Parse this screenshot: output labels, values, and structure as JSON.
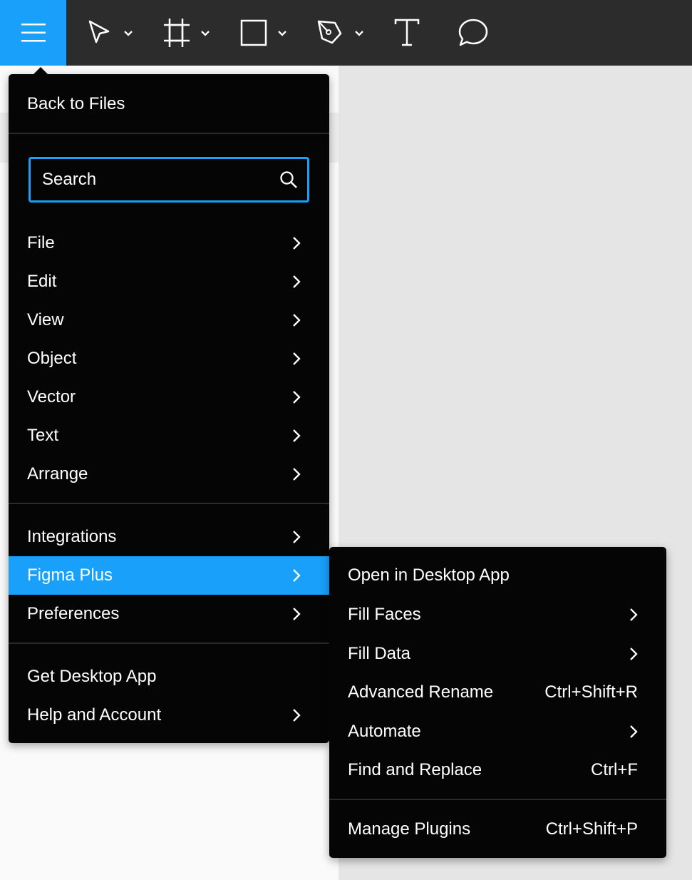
{
  "colors": {
    "accent": "#18a0fb",
    "toolbar_bg": "#2c2c2c",
    "menu_bg": "#050505",
    "canvas": "#e5e5e5"
  },
  "toolbar": {
    "icons": [
      "hamburger-icon",
      "move-tool-icon",
      "frame-tool-icon",
      "rectangle-tool-icon",
      "pen-tool-icon",
      "text-tool-icon",
      "comment-icon"
    ]
  },
  "menu": {
    "back_label": "Back to Files",
    "search": {
      "placeholder": "Search",
      "value": ""
    },
    "group1": [
      {
        "label": "File"
      },
      {
        "label": "Edit"
      },
      {
        "label": "View"
      },
      {
        "label": "Object"
      },
      {
        "label": "Vector"
      },
      {
        "label": "Text"
      },
      {
        "label": "Arrange"
      }
    ],
    "group2": [
      {
        "label": "Integrations"
      },
      {
        "label": "Figma Plus"
      },
      {
        "label": "Preferences"
      }
    ],
    "group3": [
      {
        "label": "Get Desktop App"
      },
      {
        "label": "Help and Account"
      }
    ]
  },
  "submenu": {
    "items": [
      {
        "label": "Open in Desktop App",
        "shortcut": ""
      },
      {
        "label": "Fill Faces",
        "shortcut": ""
      },
      {
        "label": "Fill Data",
        "shortcut": ""
      },
      {
        "label": "Advanced Rename",
        "shortcut": "Ctrl+Shift+R"
      },
      {
        "label": "Automate",
        "shortcut": ""
      },
      {
        "label": "Find and Replace",
        "shortcut": "Ctrl+F"
      }
    ],
    "footer": {
      "label": "Manage Plugins",
      "shortcut": "Ctrl+Shift+P"
    }
  }
}
